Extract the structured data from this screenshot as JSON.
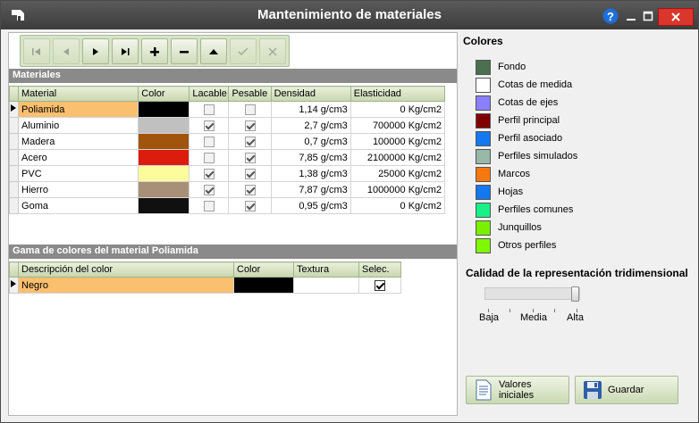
{
  "window": {
    "title": "Mantenimiento de materiales"
  },
  "materials": {
    "section_title": "Materiales",
    "columns": [
      "Material",
      "Color",
      "Lacable",
      "Pesable",
      "Densidad",
      "Elasticidad"
    ],
    "rows": [
      {
        "name": "Poliamida",
        "color": "#000000",
        "lacable": false,
        "pesable": false,
        "density": "1,14 g/cm3",
        "elasticity": "0 Kg/cm2"
      },
      {
        "name": "Aluminio",
        "color": "#c0c0c0",
        "lacable": true,
        "pesable": true,
        "density": "2,7 g/cm3",
        "elasticity": "700000 Kg/cm2"
      },
      {
        "name": "Madera",
        "color": "#a0540c",
        "lacable": false,
        "pesable": true,
        "density": "0,7 g/cm3",
        "elasticity": "100000 Kg/cm2"
      },
      {
        "name": "Acero",
        "color": "#dc1c0c",
        "lacable": false,
        "pesable": true,
        "density": "7,85 g/cm3",
        "elasticity": "2100000 Kg/cm2"
      },
      {
        "name": "PVC",
        "color": "#fcfc9c",
        "lacable": true,
        "pesable": true,
        "density": "1,38 g/cm3",
        "elasticity": "25000 Kg/cm2"
      },
      {
        "name": "Hierro",
        "color": "#a89078",
        "lacable": true,
        "pesable": true,
        "density": "7,87 g/cm3",
        "elasticity": "1000000 Kg/cm2"
      },
      {
        "name": "Goma",
        "color": "#101010",
        "lacable": false,
        "pesable": true,
        "density": "0,95 g/cm3",
        "elasticity": "0 Kg/cm2"
      }
    ]
  },
  "gamma": {
    "section_title": "Gama de colores del material Poliamida",
    "columns": [
      "Descripción del color",
      "Color",
      "Textura",
      "Selec."
    ],
    "rows": [
      {
        "description": "Negro",
        "color": "#000000",
        "texture": "",
        "selected": true
      }
    ]
  },
  "colors": {
    "title": "Colores",
    "items": [
      {
        "label": "Fondo",
        "color": "#4a7050"
      },
      {
        "label": "Cotas de medida",
        "color": "#ffffff"
      },
      {
        "label": "Cotas de ejes",
        "color": "#8a80ff"
      },
      {
        "label": "Perfil principal",
        "color": "#800000"
      },
      {
        "label": "Perfil asociado",
        "color": "#1478f0"
      },
      {
        "label": "Perfiles simulados",
        "color": "#98b8a8"
      },
      {
        "label": "Marcos",
        "color": "#f87810"
      },
      {
        "label": "Hojas",
        "color": "#1478f0"
      },
      {
        "label": "Perfiles comunes",
        "color": "#18f088"
      },
      {
        "label": "Junquillos",
        "color": "#78f000"
      },
      {
        "label": "Otros perfiles",
        "color": "#80f800"
      }
    ]
  },
  "quality": {
    "title": "Calidad de la representación tridimensional",
    "labels": [
      "Baja",
      "Media",
      "Alta"
    ],
    "value_fraction": 1.0
  },
  "buttons": {
    "reset_label": "Valores iniciales",
    "save_label": "Guardar"
  },
  "accent_colors": {
    "titlebar": "#3c3c3c",
    "close": "#d9362c",
    "toolbar": "#d8e4c6",
    "selected_row": "#fbbf70"
  }
}
